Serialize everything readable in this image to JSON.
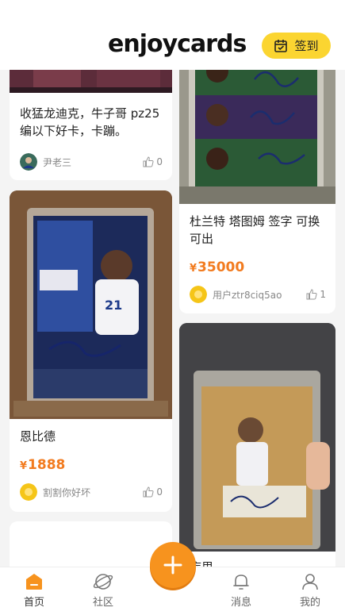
{
  "header": {
    "logo_pre": "enjoy",
    "logo_accent": "",
    "logo_post": "cards",
    "checkin_label": "签到"
  },
  "feed": {
    "left": [
      {
        "title": "收猛龙迪克，牛子哥 pz25 编以下好卡，卡蹦。",
        "user": "尹老三",
        "likes": "0"
      },
      {
        "title": "恩比德",
        "price_symbol": "¥",
        "price": "1888",
        "user": "割割你好坏",
        "likes": "0"
      }
    ],
    "right": [
      {
        "title": "杜兰特 塔图姆 签字 可换可出",
        "price_symbol": "¥",
        "price": "35000",
        "user": "用户ztr8ciq5ao",
        "likes": "1"
      },
      {
        "title": "库里"
      }
    ]
  },
  "tabbar": {
    "items": [
      {
        "label": "首页",
        "icon": "home-icon"
      },
      {
        "label": "社区",
        "icon": "community-icon"
      },
      {
        "label": "消息",
        "icon": "bell-icon"
      },
      {
        "label": "我的",
        "icon": "profile-icon"
      }
    ],
    "fab_icon": "plus-icon"
  },
  "colors": {
    "accent": "#f7931e",
    "price": "#f27b1f",
    "checkin_bg": "#fbd531"
  }
}
